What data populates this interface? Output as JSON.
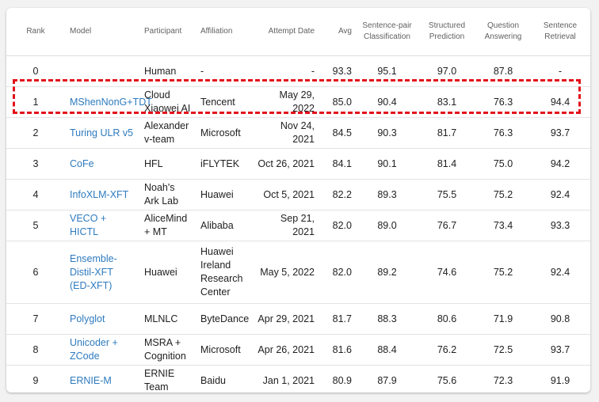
{
  "headers": {
    "rank": "Rank",
    "model": "Model",
    "participant": "Participant",
    "affiliation": "Affiliation",
    "attempt_date": "Attempt Date",
    "avg": "Avg",
    "spc": "Sentence-pair Classification",
    "sp": "Structured Prediction",
    "qa": "Question Answering",
    "sr": "Sentence Retrieval"
  },
  "rows": [
    {
      "rank": "0",
      "model": "",
      "participant": "Human",
      "affiliation": "-",
      "date": "-",
      "avg": "93.3",
      "spc": "95.1",
      "sp": "97.0",
      "qa": "87.8",
      "sr": "-"
    },
    {
      "rank": "1",
      "model": "MShenNonG+TDT",
      "participant": "Cloud Xiaowei AI",
      "affiliation": "Tencent",
      "date": "May 29, 2022",
      "avg": "85.0",
      "spc": "90.4",
      "sp": "83.1",
      "qa": "76.3",
      "sr": "94.4"
    },
    {
      "rank": "2",
      "model": "Turing ULR v5",
      "participant": "Alexander v-team",
      "affiliation": "Microsoft",
      "date": "Nov 24, 2021",
      "avg": "84.5",
      "spc": "90.3",
      "sp": "81.7",
      "qa": "76.3",
      "sr": "93.7"
    },
    {
      "rank": "3",
      "model": "CoFe",
      "participant": "HFL",
      "affiliation": "iFLYTEK",
      "date": "Oct 26, 2021",
      "avg": "84.1",
      "spc": "90.1",
      "sp": "81.4",
      "qa": "75.0",
      "sr": "94.2"
    },
    {
      "rank": "4",
      "model": "InfoXLM-XFT",
      "participant": "Noah's Ark Lab",
      "affiliation": "Huawei",
      "date": "Oct 5, 2021",
      "avg": "82.2",
      "spc": "89.3",
      "sp": "75.5",
      "qa": "75.2",
      "sr": "92.4"
    },
    {
      "rank": "5",
      "model": "VECO + HICTL",
      "participant": "AliceMind + MT",
      "affiliation": "Alibaba",
      "date": "Sep 21, 2021",
      "avg": "82.0",
      "spc": "89.0",
      "sp": "76.7",
      "qa": "73.4",
      "sr": "93.3"
    },
    {
      "rank": "6",
      "model": "Ensemble-Distil-XFT (ED-XFT)",
      "participant": "Huawei",
      "affiliation": "Huawei Ireland Research Center",
      "date": "May 5, 2022",
      "avg": "82.0",
      "spc": "89.2",
      "sp": "74.6",
      "qa": "75.2",
      "sr": "92.4"
    },
    {
      "rank": "7",
      "model": "Polyglot",
      "participant": "MLNLC",
      "affiliation": "ByteDance",
      "date": "Apr 29, 2021",
      "avg": "81.7",
      "spc": "88.3",
      "sp": "80.6",
      "qa": "71.9",
      "sr": "90.8"
    },
    {
      "rank": "8",
      "model": "Unicoder + ZCode",
      "participant": "MSRA + Cognition",
      "affiliation": "Microsoft",
      "date": "Apr 26, 2021",
      "avg": "81.6",
      "spc": "88.4",
      "sp": "76.2",
      "qa": "72.5",
      "sr": "93.7"
    },
    {
      "rank": "9",
      "model": "ERNIE-M",
      "participant": "ERNIE Team",
      "affiliation": "Baidu",
      "date": "Jan 1, 2021",
      "avg": "80.9",
      "spc": "87.9",
      "sp": "75.6",
      "qa": "72.3",
      "sr": "91.9"
    }
  ],
  "colors": {
    "link": "#2e7bbf",
    "highlight_border": "#e3121a"
  }
}
